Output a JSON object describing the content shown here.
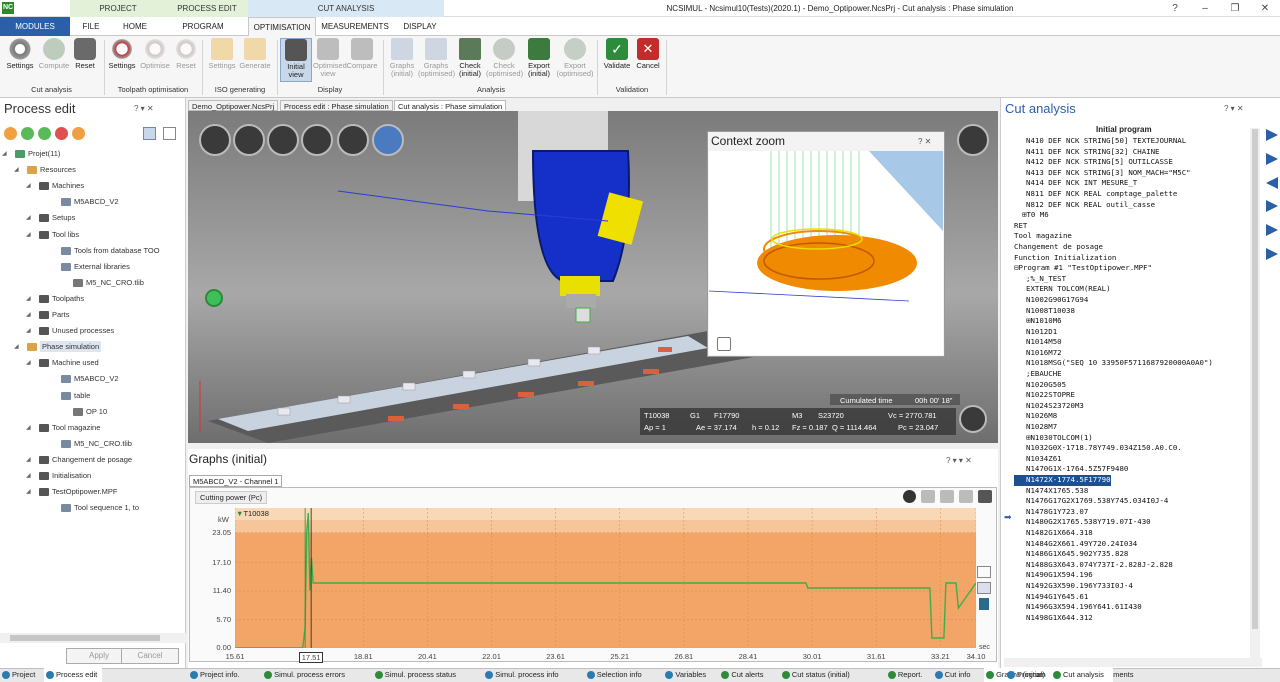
{
  "app": {
    "logo": "NC",
    "window_title": "NCSIMUL - Ncsimul10(Tests)(2020.1) - Demo_Optipower.NcsPrj - Cut analysis : Phase simulation",
    "context_tabs": [
      "PROJECT",
      "PROCESS EDIT",
      "CUT ANALYSIS"
    ],
    "window_controls": [
      "?",
      "–",
      "❐",
      "✕"
    ]
  },
  "ribbon": {
    "tabs": [
      "MODULES",
      "FILE",
      "HOME",
      "PROGRAM",
      "OPTIMISATION",
      "MEASUREMENTS",
      "DISPLAY"
    ],
    "active_tab": "OPTIMISATION",
    "groups": [
      {
        "label": "Cut analysis",
        "buttons": [
          "Settings",
          "Compute",
          "Reset"
        ]
      },
      {
        "label": "Toolpath optimisation",
        "buttons": [
          "Settings",
          "Optimise",
          "Reset"
        ]
      },
      {
        "label": "ISO generating",
        "buttons": [
          "Settings",
          "Generate"
        ]
      },
      {
        "label": "Display",
        "buttons": [
          "Initial view",
          "Optimised view",
          "Compare"
        ]
      },
      {
        "label": "Analysis",
        "buttons": [
          "Graphs (initial)",
          "Graphs (optimised)",
          "Check (initial)",
          "Check (optimised)",
          "Export (initial)",
          "Export (optimised)"
        ]
      },
      {
        "label": "Validation",
        "buttons": [
          "Validate",
          "Cancel"
        ]
      }
    ]
  },
  "left_panel": {
    "title": "Process edit",
    "header_controls": "? ▾ ✕",
    "tree": [
      {
        "label": "Projet(11)",
        "level": 0
      },
      {
        "label": "Resources",
        "level": 1
      },
      {
        "label": "Machines",
        "level": 2
      },
      {
        "label": "M5ABCD_V2",
        "level": 3
      },
      {
        "label": "Setups",
        "level": 2
      },
      {
        "label": "Tool libs",
        "level": 2
      },
      {
        "label": "Tools from database TOO",
        "level": 3
      },
      {
        "label": "External libraries",
        "level": 3
      },
      {
        "label": "M5_NC_CRO.tlib",
        "level": 4
      },
      {
        "label": "Toolpaths",
        "level": 2
      },
      {
        "label": "Parts",
        "level": 2
      },
      {
        "label": "Unused processes",
        "level": 2
      },
      {
        "label": "Phase simulation",
        "level": 1
      },
      {
        "label": "Machine used",
        "level": 2
      },
      {
        "label": "M5ABCD_V2",
        "level": 3
      },
      {
        "label": "table",
        "level": 3
      },
      {
        "label": "OP 10",
        "level": 4
      },
      {
        "label": "Tool magazine",
        "level": 2
      },
      {
        "label": "M5_NC_CRO.tlib",
        "level": 3
      },
      {
        "label": "Changement de posage",
        "level": 2
      },
      {
        "label": "Initialisation",
        "level": 2
      },
      {
        "label": "TestOptipower.MPF",
        "level": 2
      },
      {
        "label": "Tool sequence 1, to",
        "level": 3
      }
    ],
    "apply": "Apply",
    "cancel": "Cancel"
  },
  "doc_tabs": [
    "Demo_Optipower.NcsPrj",
    "Process edit : Phase simulation",
    "Cut analysis : Phase simulation"
  ],
  "viewer": {
    "context_zoom_title": "Context zoom",
    "context_zoom_controls": "? ✕",
    "cumulated_time_label": "Cumulated time",
    "cumulated_time": "00h 00' 18\"",
    "hud_row1": [
      "T10038",
      "G1",
      "F17790",
      "M3",
      "S23720",
      "Vc = 2770.781"
    ],
    "hud_row2": [
      "Ap = 1",
      "Ae = 37.174",
      "h = 0.12",
      "Fz = 0.187",
      "Q = 1114.464",
      "Pc = 23.047"
    ]
  },
  "graphs": {
    "title": "Graphs (initial)",
    "header_controls": "? ▾ ▾ ✕",
    "channel_tab": "M5ABCD_V2 - Channel 1",
    "series_button": "Cutting power (Pc)",
    "tool_marker": "T10038",
    "unit": "kW",
    "x_unit": "sec",
    "cursor_label": "17.51"
  },
  "chart_data": {
    "type": "line",
    "title": "",
    "xlabel": "sec",
    "ylabel": "kW",
    "yticks": [
      "0.00",
      "5.70",
      "11.40",
      "17.10",
      "23.05"
    ],
    "xticks": [
      "15.61",
      "17.51",
      "18.81",
      "20.41",
      "22.01",
      "23.61",
      "25.21",
      "26.81",
      "28.41",
      "30.01",
      "31.61",
      "33.21",
      "34.10"
    ],
    "xlim": [
      15.61,
      34.1
    ],
    "ylim": [
      0,
      28
    ],
    "bands": [
      {
        "from": 23.05,
        "to": 25.6,
        "color": "#f7c59a"
      },
      {
        "from": 25.6,
        "to": 28,
        "color": "#f9d8b8"
      }
    ],
    "fill_color": "#f2a566",
    "line_color": "#3fae49",
    "series": [
      {
        "x": [
          15.61,
          17.3,
          17.36,
          17.4,
          17.44,
          17.48,
          17.52,
          17.56,
          17.62,
          29.86,
          29.9,
          32.95,
          33.0,
          33.08,
          33.3,
          33.35,
          33.6,
          33.66,
          34.1
        ],
        "y": [
          0.0,
          0.0,
          4.0,
          23.0,
          27.0,
          11.5,
          18.0,
          13.0,
          13.0,
          13.0,
          12.0,
          12.0,
          2.0,
          2.0,
          2.0,
          13.0,
          13.0,
          8.0,
          13.0
        ]
      }
    ]
  },
  "right_panel": {
    "title": "Cut analysis",
    "header_controls": "? ▾ ✕",
    "section_header": "Initial program",
    "current_line": "N1472X-1774.5F17790",
    "lines": [
      "N410 DEF NCK STRING[50] TEXTEJOURNAL",
      "N411 DEF NCK STRING[32] CHAINE",
      "N412 DEF NCK STRING[5] OUTILCASSE",
      "N413 DEF NCK STRING[3] NOM_MACH=\"M5C\"",
      "N414 DEF NCK INT MESURE_T",
      "",
      "N811 DEF NCK REAL comptage_palette",
      "N812 DEF NCK REAL outil_casse",
      "",
      "⊞T0 M6",
      "",
      "RET",
      "Tool magazine",
      "Changement de posage",
      "Function Initialization",
      "⊟Program #1 \"TestOptipower.MPF\"",
      ";%_N_TEST",
      "EXTERN TOLCOM(REAL)",
      "N1002G90G17G94",
      "N1008T10038",
      "⊞N1010M6",
      "N1012D1",
      "N1014M50",
      "N1016M72",
      "N1018MSG(\"SEQ 10 33950F5711687920000A0A0\")",
      ";EBAUCHE",
      "N1020G505",
      "N1022STOPRE",
      "N1024S23720M3",
      "N1026M8",
      "N1028M7",
      "⊞N1030TOLCOM(1)",
      "N1032G0X-1718.78Y749.034Z150.A0.C0.",
      "N1034Z61",
      "N1470G1X-1764.5Z57F9480",
      "N1472X-1774.5F17790",
      "N1474X1765.538",
      "N1476G17G2X1769.538Y745.034I0J-4",
      "N1478G1Y723.07",
      "N1480G2X1765.538Y719.07I-430",
      "N1482G1X664.318",
      "N1484G2X661.49Y720.24I034",
      "N1486G1X645.902Y735.828",
      "N1488G3X643.074Y737I-2.828J-2.828",
      "N1490G1X594.196",
      "N1492G3X590.196Y733I0J-4",
      "N1494G1Y645.61",
      "N1496G3X594.196Y641.61I430",
      "N1498G1X644.312"
    ]
  },
  "status_bar": {
    "left_tabs": [
      "Project",
      "Process edit"
    ],
    "bottom_tabs": [
      "Project info.",
      "Simul. process errors",
      "Simul. process status",
      "Simul. process info",
      "Selection info",
      "Variables",
      "Cut alerts",
      "Cut status (initial)",
      "Report.",
      "Cut info",
      "Graphs (initial)",
      "Measurements"
    ],
    "right_tabs": [
      "Program",
      "Cut analysis"
    ]
  }
}
